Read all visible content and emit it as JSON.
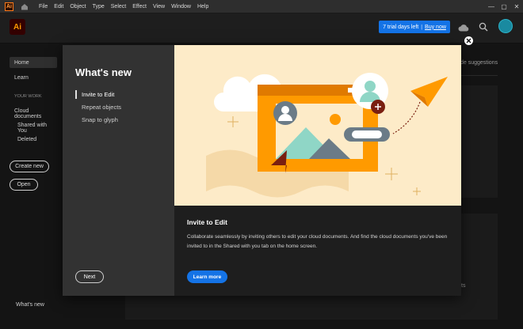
{
  "menubar": {
    "app_icon": "Ai",
    "items": [
      "File",
      "Edit",
      "Object",
      "Type",
      "Select",
      "Effect",
      "View",
      "Window",
      "Help"
    ],
    "window_controls": {
      "minimize": "—",
      "maximize": "▢",
      "close": "✕"
    }
  },
  "header": {
    "app_logo": "Ai",
    "trial_text": "7 trial days left",
    "trial_separator": "|",
    "buy_label": "Buy now"
  },
  "sidebar": {
    "home": "Home",
    "learn": "Learn",
    "your_work": "YOUR WORK",
    "cloud_documents": "Cloud documents",
    "shared_with_you": "Shared with You",
    "deleted": "Deleted",
    "create_new": "Create new",
    "open": "Open",
    "whats_new": "What's new"
  },
  "background": {
    "hide_suggestions": "de suggestions",
    "peek_text": "ts"
  },
  "modal": {
    "title": "What's new",
    "nav": [
      "Invite to Edit",
      "Repeat objects",
      "Snap to glyph"
    ],
    "next_label": "Next",
    "feature_title": "Invite to Edit",
    "feature_body": "Collaborate seamlessly by inviting others to edit your cloud documents. And find the cloud documents you've been invited to in the Shared with you tab on the home screen.",
    "learn_more": "Learn more"
  },
  "colors": {
    "accent_blue": "#1473e6",
    "illustration_bg": "#fdebc8",
    "orange": "#ff9a00",
    "teal": "#8fd6c6"
  }
}
